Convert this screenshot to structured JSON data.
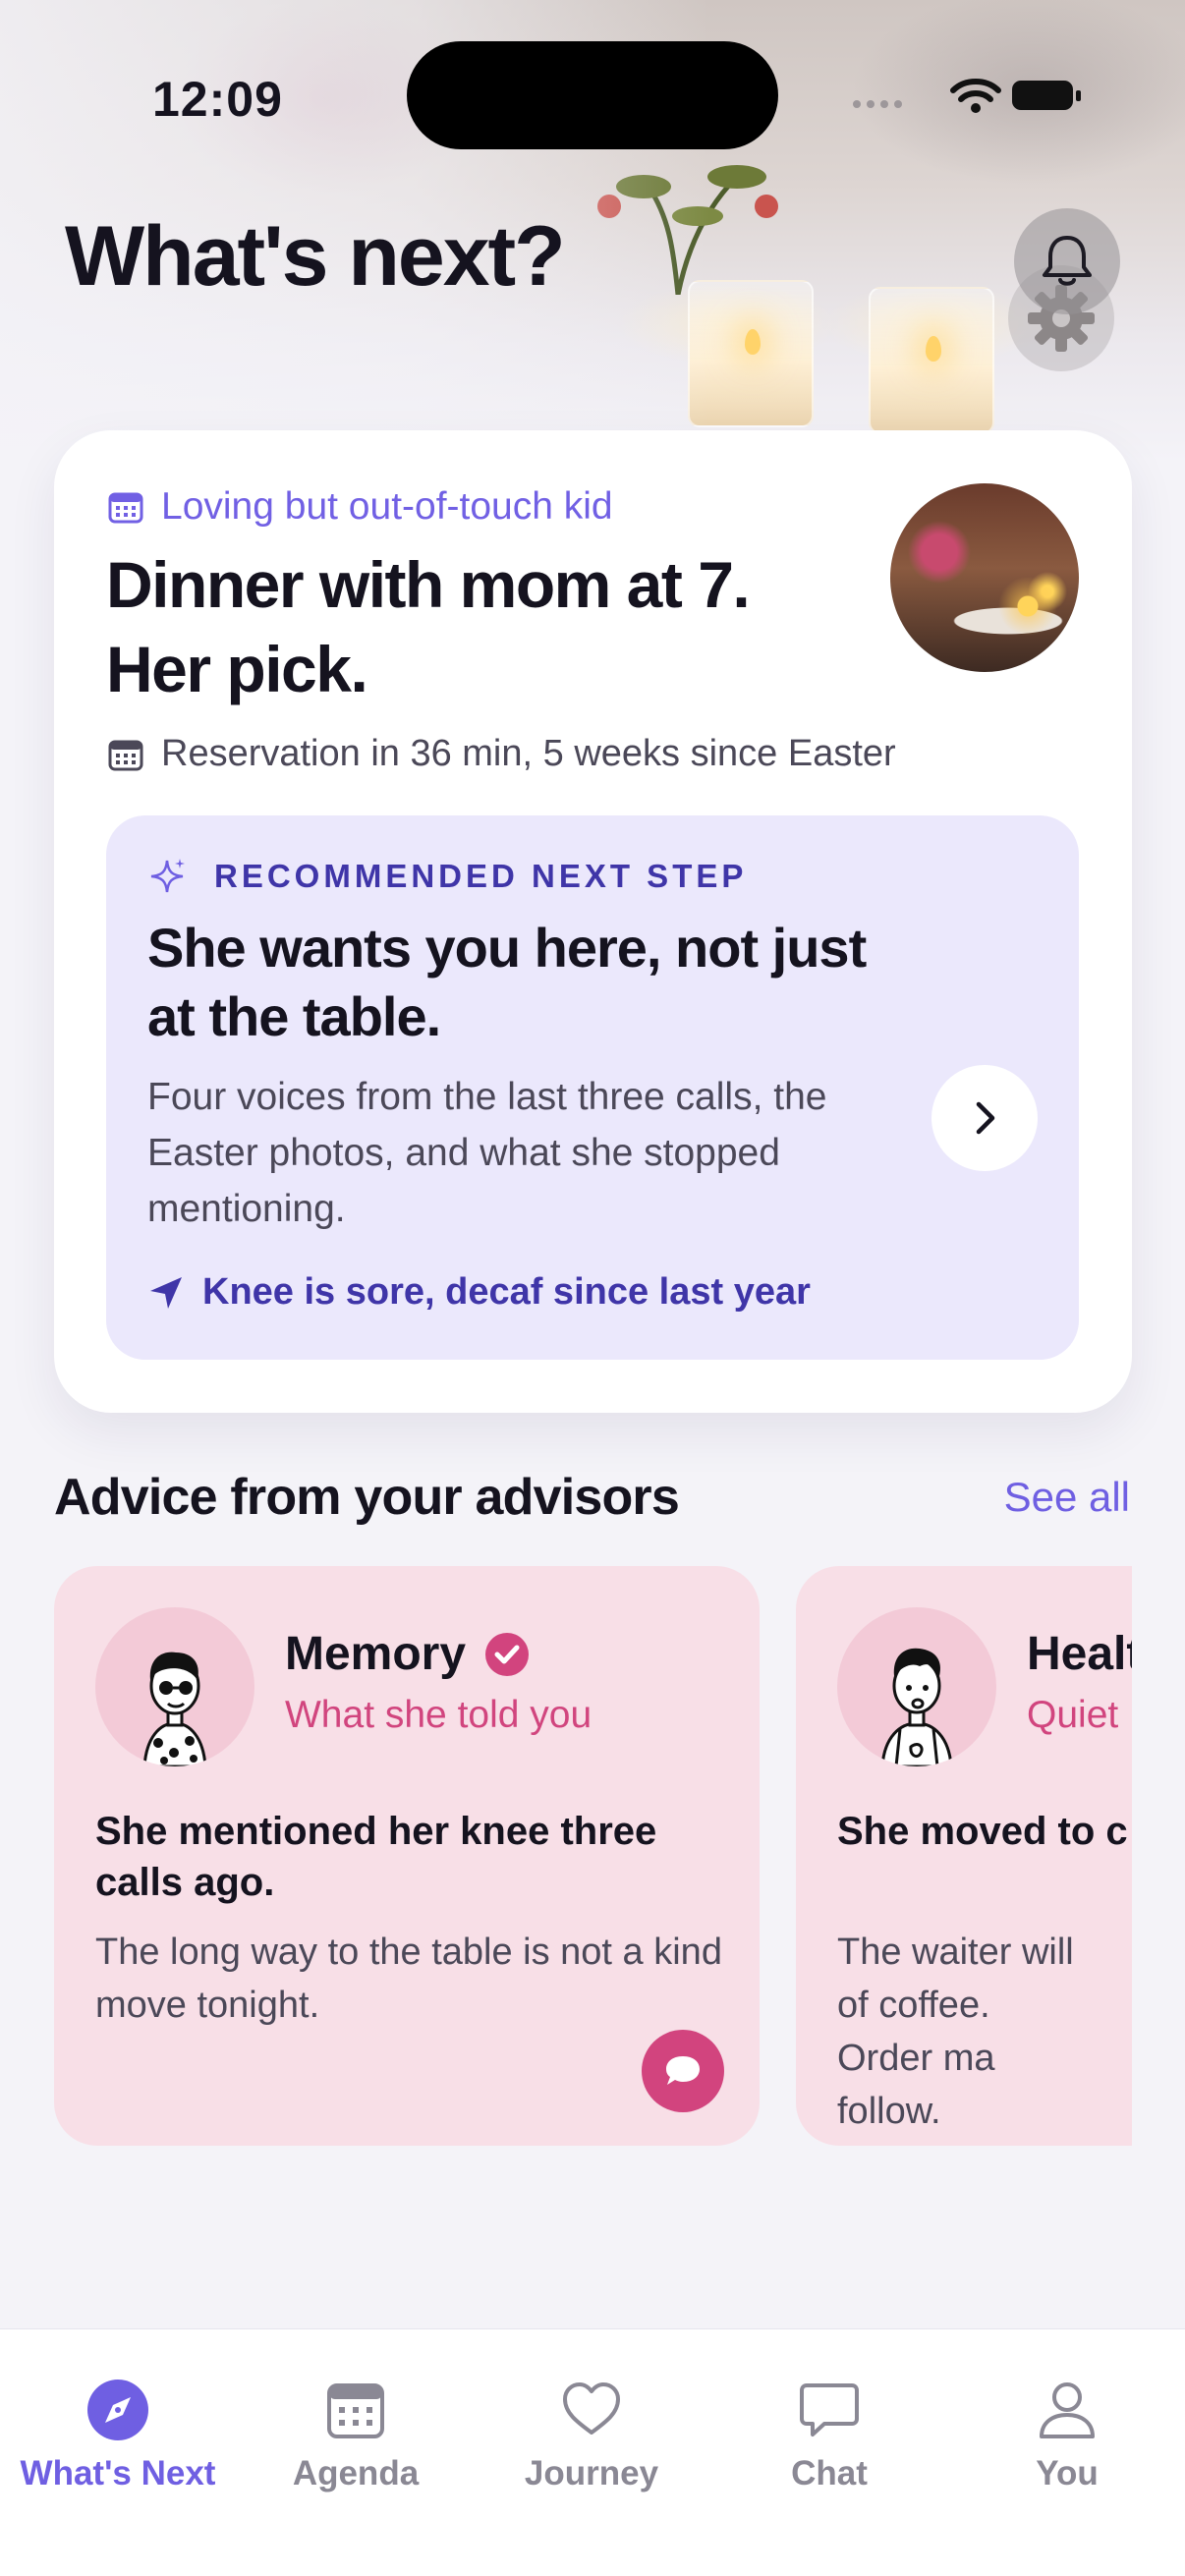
{
  "status_bar": {
    "time": "12:09"
  },
  "header": {
    "title": "What's next?"
  },
  "featured": {
    "persona": "Loving but out-of-touch kid",
    "title_line1": "Dinner with mom at 7.",
    "title_line2": "Her pick.",
    "meta": "Reservation in 36 min, 5 weeks since Easter",
    "recommendation": {
      "label": "RECOMMENDED NEXT STEP",
      "title": "She wants you here, not just at the table.",
      "body": "Four voices from the last three calls, the Easter photos, and what she stopped mentioning.",
      "footnote": "Knee is sore, decaf since last year"
    }
  },
  "advisors": {
    "section_title": "Advice from your advisors",
    "see_all": "See all",
    "cards": [
      {
        "name": "Memory",
        "subtitle": "What she told you",
        "headline": "She mentioned her knee three calls ago.",
        "text": "The long way to the table is not a kind move tonight.",
        "verified": true
      },
      {
        "name": "Healt",
        "subtitle": "Quiet",
        "headline": "She moved to c",
        "text": "The waiter will of coffee. Order ma follow."
      }
    ]
  },
  "tabbar": {
    "tabs": [
      {
        "label": "What's Next",
        "icon": "compass-icon",
        "active": true
      },
      {
        "label": "Agenda",
        "icon": "calendar-icon"
      },
      {
        "label": "Journey",
        "icon": "heart-icon"
      },
      {
        "label": "Chat",
        "icon": "chat-bubble-icon"
      },
      {
        "label": "You",
        "icon": "person-icon"
      }
    ]
  },
  "colors": {
    "accent": "#6f5fe2",
    "recommendation_bg": "#ebe8fc",
    "advisor_card_bg": "#f8dfe7",
    "advisor_accent": "#d2447e"
  }
}
